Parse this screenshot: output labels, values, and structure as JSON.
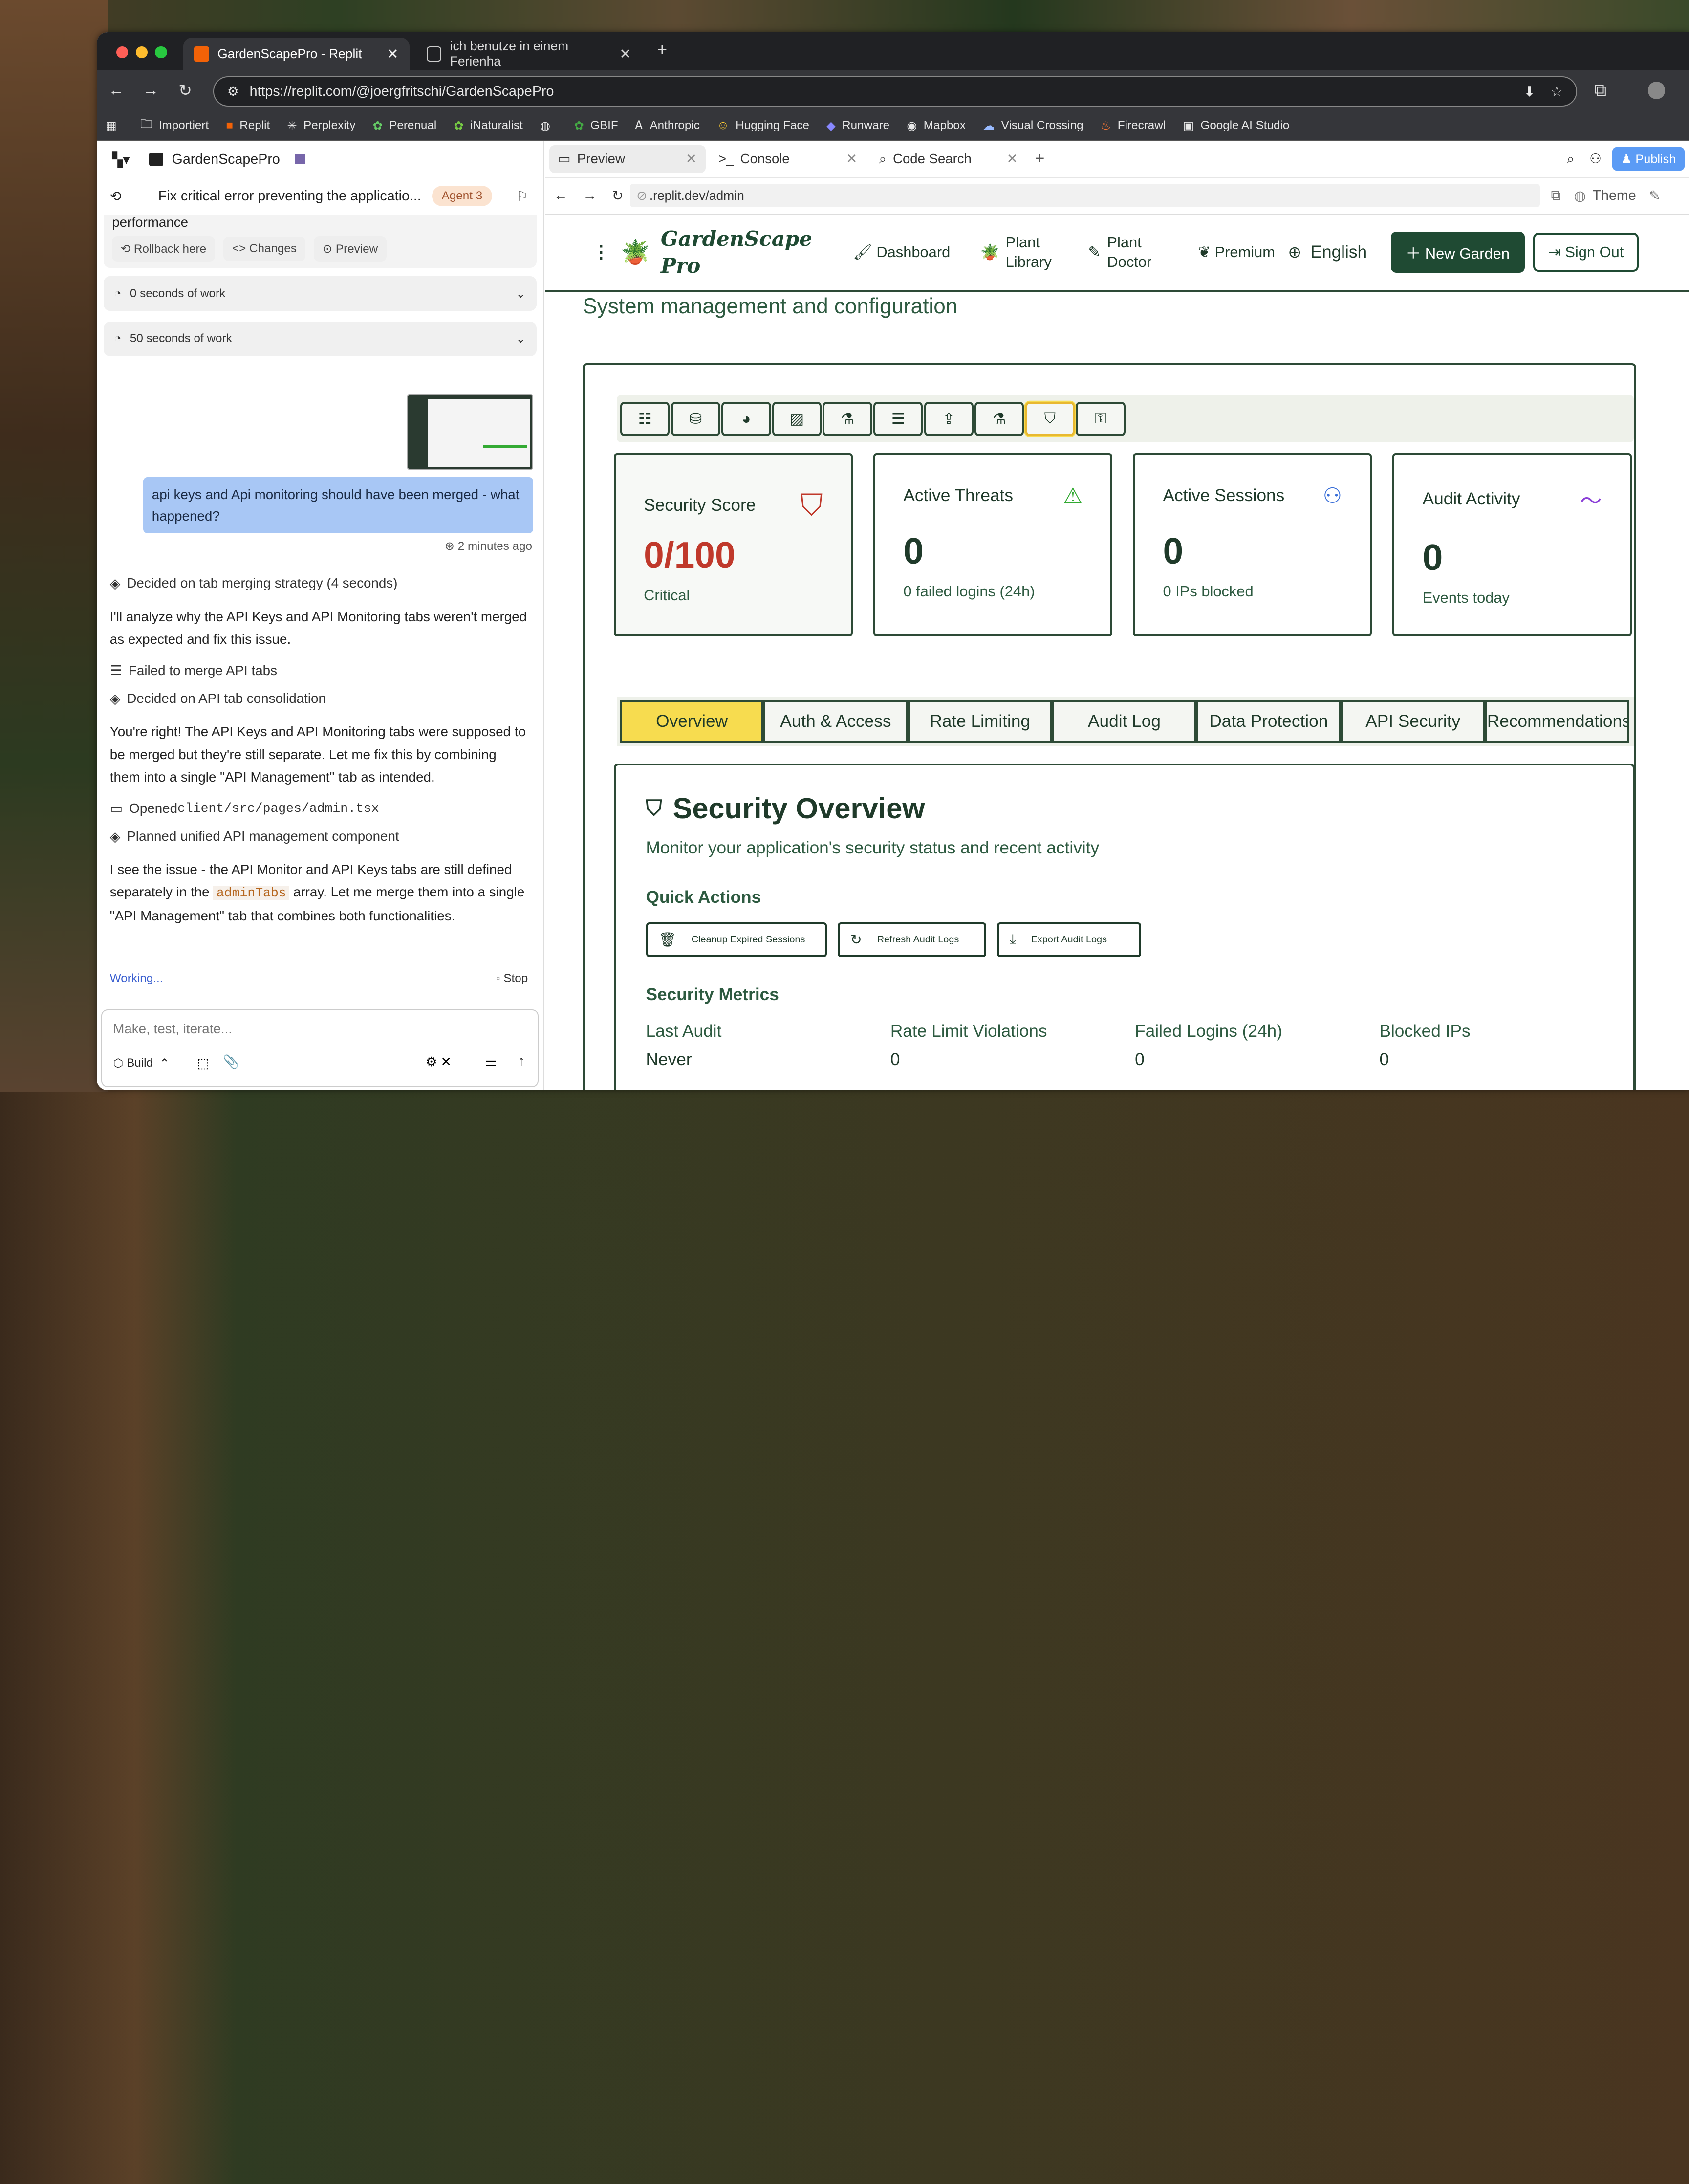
{
  "browser": {
    "tabs": [
      {
        "title": "GardenScapePro - Replit",
        "active": true
      },
      {
        "title": "ich benutze in einem Ferienha",
        "active": false
      }
    ],
    "url": "https://replit.com/@joergfritschi/GardenScapePro",
    "bookmarks": [
      "Importiert",
      "Replit",
      "Perplexity",
      "Perenual",
      "iNaturalist",
      "GBIF",
      "Anthropic",
      "Hugging Face",
      "Runware",
      "Mapbox",
      "Visual Crossing",
      "Firecrawl",
      "Google AI Studio"
    ]
  },
  "left": {
    "project": "GardenScapePro",
    "checkpoint_title": "Fix critical error preventing the applicatio...",
    "agent_badge": "Agent 3",
    "prev_tail": "performance",
    "chips": [
      "Rollback here",
      "Changes",
      "Preview"
    ],
    "work1": "0 seconds of work",
    "work2": "50 seconds of work",
    "user_msg": "api keys and Api monitoring should have been merged - what happened?",
    "msg_time": "2 minutes ago",
    "steps": {
      "s1": "Decided on tab merging strategy (4 seconds)",
      "p1": "I'll analyze why the API Keys and API Monitoring tabs weren't merged as expected and fix this issue.",
      "s2": "Failed to merge API tabs",
      "s3": "Decided on API tab consolidation",
      "p2": "You're right! The API Keys and API Monitoring tabs were supposed to be merged but they're still separate. Let me fix this by combining them into a single \"API Management\" tab as intended.",
      "s4_pre": "Opened ",
      "s4_code": "client/src/pages/admin.tsx",
      "s5": "Planned unified API management component",
      "p3_a": "I see the issue - the API Monitor and API Keys tabs are still defined separately in the ",
      "p3_code": "adminTabs",
      "p3_b": " array. Let me merge them into a single \"API Management\" tab that combines both functionalities."
    },
    "working": "Working...",
    "stop": "Stop",
    "input_placeholder": "Make, test, iterate...",
    "build": "Build"
  },
  "right": {
    "tabs": [
      "Preview",
      "Console",
      "Code Search"
    ],
    "publish": "Publish",
    "url": ".replit.dev/admin",
    "theme": "Theme"
  },
  "app": {
    "logo_line1": "GardenScape",
    "logo_line2": "Pro",
    "nav": {
      "dashboard": "Dashboard",
      "plant_library": "Plant Library",
      "plant_doctor": "Plant Doctor",
      "premium": "Premium",
      "language": "English",
      "new_garden": "New Garden",
      "sign_out": "Sign Out"
    },
    "subtitle": "System management and configuration",
    "cards": [
      {
        "title": "Security Score",
        "value": "0/100",
        "sub": "Critical"
      },
      {
        "title": "Active Threats",
        "value": "0",
        "sub": "0 failed logins (24h)"
      },
      {
        "title": "Active Sessions",
        "value": "0",
        "sub": "0 IPs blocked"
      },
      {
        "title": "Audit Activity",
        "value": "0",
        "sub": "Events today"
      }
    ],
    "sec_tabs": [
      "Overview",
      "Auth & Access",
      "Rate Limiting",
      "Audit Log",
      "Data Protection",
      "API Security",
      "Recommendations"
    ],
    "overview_title": "Security Overview",
    "overview_desc": "Monitor your application's security status and recent activity",
    "quick_actions": "Quick Actions",
    "qa": [
      "Cleanup Expired Sessions",
      "Refresh Audit Logs",
      "Export Audit Logs"
    ],
    "metrics_title": "Security Metrics",
    "metrics": [
      {
        "label": "Last Audit",
        "value": "Never"
      },
      {
        "label": "Rate Limit Violations",
        "value": "0"
      },
      {
        "label": "Failed Logins (24h)",
        "value": "0"
      },
      {
        "label": "Blocked IPs",
        "value": "0"
      }
    ]
  },
  "colors": {
    "accent_yellow": "#f7dc4f",
    "brand_green": "#1f4a33",
    "critical_red": "#c0392b",
    "user_bubble": "#a8c7f5"
  }
}
